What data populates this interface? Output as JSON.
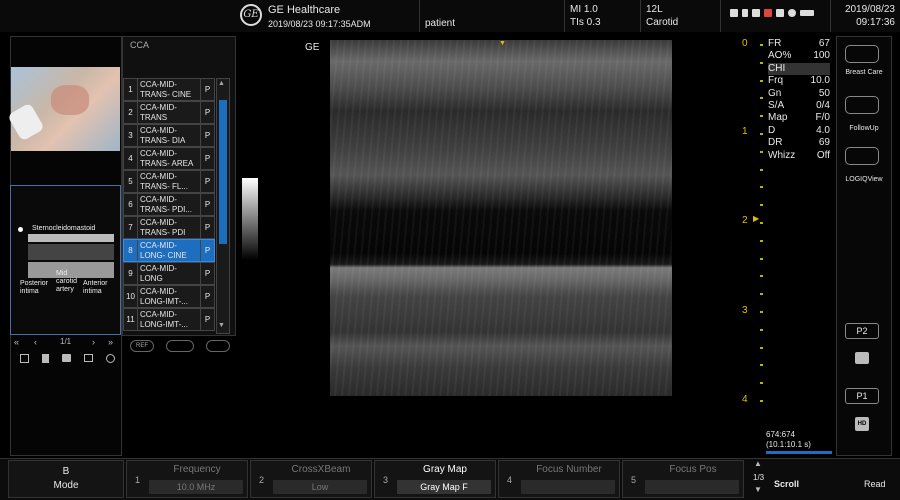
{
  "header": {
    "brand": "GE Healthcare",
    "datetime": "2019/08/23 09:17:35ADM",
    "patient_label": "patient",
    "mi": "MI 1.0",
    "tis": "TIs 0.3",
    "probe": "12L",
    "preset": "Carotid",
    "date": "2019/08/23",
    "time": "09:17:36"
  },
  "thumbnails": {
    "labels": [
      "Sternocleidomastoid",
      "Posterior intima",
      "Mid carotid artery",
      "Anterior intima"
    ],
    "nav_text": "1/1"
  },
  "study_list": {
    "title": "CCA",
    "items": [
      {
        "num": "1",
        "label": "CCA-MID-TRANS- CINE",
        "flag": "P"
      },
      {
        "num": "2",
        "label": "CCA-MID-TRANS",
        "flag": "P"
      },
      {
        "num": "3",
        "label": "CCA-MID-TRANS- DIA",
        "flag": "P"
      },
      {
        "num": "4",
        "label": "CCA-MID-TRANS- AREA",
        "flag": "P"
      },
      {
        "num": "5",
        "label": "CCA-MID-TRANS- FL...",
        "flag": "P"
      },
      {
        "num": "6",
        "label": "CCA-MID-TRANS- PDI...",
        "flag": "P"
      },
      {
        "num": "7",
        "label": "CCA-MID-TRANS- PDI",
        "flag": "P"
      },
      {
        "num": "8",
        "label": "CCA-MID-LONG- CINE",
        "flag": "P",
        "selected": true
      },
      {
        "num": "9",
        "label": "CCA-MID-LONG",
        "flag": "P"
      },
      {
        "num": "10",
        "label": "CCA-MID-LONG-IMT-...",
        "flag": "P"
      },
      {
        "num": "11",
        "label": "CCA-MID-LONG-IMT-...",
        "flag": "P"
      }
    ]
  },
  "image": {
    "ge_label": "GE",
    "depth_labels": [
      "0",
      "1",
      "2",
      "3",
      "4"
    ]
  },
  "params": [
    {
      "k": "FR",
      "v": "67"
    },
    {
      "k": "AO%",
      "v": "100"
    },
    {
      "k": "CHI",
      "v": ""
    },
    {
      "k": "Frq",
      "v": "10.0"
    },
    {
      "k": "Gn",
      "v": "50"
    },
    {
      "k": "S/A",
      "v": "0/4"
    },
    {
      "k": "Map",
      "v": "F/0"
    },
    {
      "k": "D",
      "v": "4.0"
    },
    {
      "k": "DR",
      "v": "69"
    },
    {
      "k": "Whizz",
      "v": "Off"
    }
  ],
  "cine": {
    "frames": "674:674",
    "ratio": "(10.1:10.1 s)"
  },
  "right_buttons": {
    "breast_care": "Breast Care",
    "followup": "FollowUp",
    "logiqview": "LOGIQView",
    "p2": "P2",
    "p1": "P1",
    "hd": "HD"
  },
  "bottom": {
    "mode_line1": "B",
    "mode_line2": "Mode",
    "cells": [
      {
        "num": "1",
        "title": "Frequency",
        "value": "10.0 MHz"
      },
      {
        "num": "2",
        "title": "CrossXBeam",
        "value": "Low"
      },
      {
        "num": "3",
        "title": "Gray Map",
        "value": "Gray Map F"
      },
      {
        "num": "4",
        "title": "Focus Number",
        "value": ""
      },
      {
        "num": "5",
        "title": "Focus Pos",
        "value": ""
      }
    ],
    "page": "1/3",
    "scroll": "Scroll",
    "read": "Read"
  }
}
